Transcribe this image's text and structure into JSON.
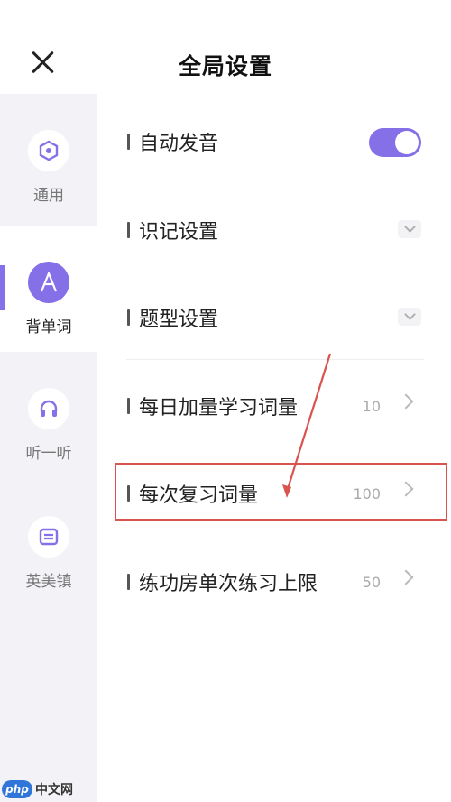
{
  "header": {
    "title": "全局设置"
  },
  "sidebar": {
    "items": [
      {
        "label": "通用",
        "icon": "hexagon-settings-icon"
      },
      {
        "label": "背单词",
        "icon": "letter-a-icon",
        "active": true
      },
      {
        "label": "听一听",
        "icon": "headphones-icon"
      },
      {
        "label": "英美镇",
        "icon": "news-icon"
      }
    ]
  },
  "settings": [
    {
      "label": "自动发音",
      "control": "toggle",
      "enabled": true
    },
    {
      "label": "识记设置",
      "control": "dropdown"
    },
    {
      "label": "题型设置",
      "control": "dropdown"
    },
    {
      "label": "每日加量学习词量",
      "value": "10",
      "control": "chevron"
    },
    {
      "label": "每次复习词量",
      "value": "100",
      "control": "chevron",
      "highlighted": true
    },
    {
      "label": "练功房单次练习上限",
      "value": "50",
      "control": "chevron"
    }
  ],
  "colors": {
    "accent": "#8670e8",
    "highlight": "#d9534f",
    "sidebar_bg": "#f3f3f7"
  },
  "watermark": {
    "logo_text": "php",
    "text": "中文网"
  }
}
